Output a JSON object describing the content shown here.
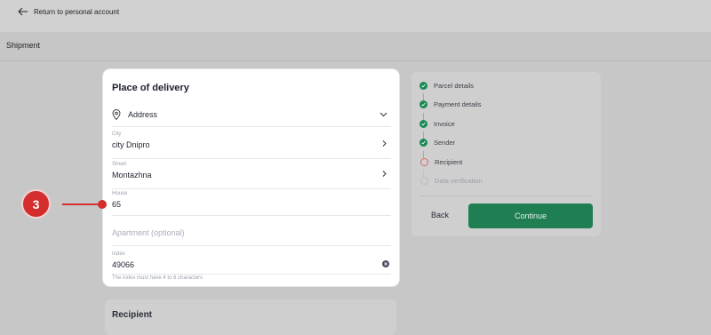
{
  "topbar": {
    "back_label": "Return to personal account"
  },
  "subbar": {
    "title": "Shipment"
  },
  "delivery": {
    "title": "Place of delivery",
    "method": "Address",
    "city_label": "City",
    "city_value": "city Dnipro",
    "street_label": "Street",
    "street_value": "Montazhna",
    "house_label": "House",
    "house_value": "65",
    "apartment_placeholder": "Apartment (optional)",
    "index_label": "Index",
    "index_value": "49066",
    "index_hint": "The index must have 4 to 6 characters"
  },
  "recipient_card": {
    "title": "Recipient"
  },
  "steps": [
    {
      "label": "Parcel details",
      "state": "done"
    },
    {
      "label": "Payment details",
      "state": "done"
    },
    {
      "label": "Invoice",
      "state": "done"
    },
    {
      "label": "Sender",
      "state": "done"
    },
    {
      "label": "Recipient",
      "state": "current"
    },
    {
      "label": "Data verification",
      "state": "todo"
    }
  ],
  "actions": {
    "back_label": "Back",
    "continue_label": "Continue"
  },
  "annotation": {
    "number": "3"
  },
  "colors": {
    "accent": "#1f7f53",
    "marker": "#d32d2d"
  }
}
